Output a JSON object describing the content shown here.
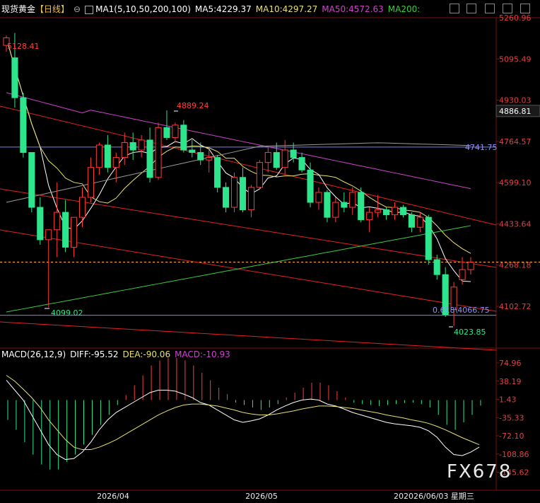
{
  "header": {
    "symbol": "现货黄金",
    "period": "【日线】",
    "ma_label": "MA1(5,10,50,200,100)",
    "ma5": "MA5:4229.37",
    "ma10": "MA10:4297.27",
    "ma50": "MA50:4572.63",
    "ma200": "MA200:"
  },
  "macd_header": {
    "label": "MACD(26,12,9)",
    "diff": "DIFF:-95.52",
    "dea": "DEA:-90.06",
    "macd": "MACD:-10.93"
  },
  "watermark": "FX678",
  "colors": {
    "up": "#ff3b3b",
    "down": "#2ee58e",
    "ma5": "#ffffff",
    "ma10": "#e8e070",
    "ma50": "#d040d0",
    "ma200": "#3ccc3c",
    "ma100": "#9a9a9a",
    "channel": "#e52020",
    "hline": "#8080ff",
    "current": "#ffb040"
  },
  "chart_data": {
    "type": "candlestick",
    "y_ticks": [
      "5260.96",
      "5095.49",
      "4930.03",
      "4764.57",
      "4599.10",
      "4433.64",
      "4268.18",
      "4102.72"
    ],
    "current_price_label": "4886.81",
    "hline_label": "4741.75",
    "x_labels": [
      "2026/04",
      "2026/05",
      "2026/06/03 星期三"
    ],
    "annotations": [
      "5128.41",
      "4889.24",
      "4099.02",
      "4023.85",
      "0.618\\4066.75"
    ],
    "candles": [
      {
        "o": 5150,
        "h": 5190,
        "l": 5125,
        "c": 5180
      },
      {
        "o": 5100,
        "h": 5200,
        "l": 4900,
        "c": 4940
      },
      {
        "o": 4940,
        "h": 4960,
        "l": 4700,
        "c": 4720
      },
      {
        "o": 4720,
        "h": 4720,
        "l": 4480,
        "c": 4500
      },
      {
        "o": 4500,
        "h": 4540,
        "l": 4350,
        "c": 4370
      },
      {
        "o": 4370,
        "h": 4400,
        "l": 4099,
        "c": 4410
      },
      {
        "o": 4410,
        "h": 4600,
        "l": 4300,
        "c": 4480
      },
      {
        "o": 4480,
        "h": 4530,
        "l": 4320,
        "c": 4340
      },
      {
        "o": 4340,
        "h": 4460,
        "l": 4300,
        "c": 4460
      },
      {
        "o": 4460,
        "h": 4580,
        "l": 4420,
        "c": 4540
      },
      {
        "o": 4540,
        "h": 4700,
        "l": 4520,
        "c": 4660
      },
      {
        "o": 4660,
        "h": 4760,
        "l": 4630,
        "c": 4750
      },
      {
        "o": 4750,
        "h": 4790,
        "l": 4640,
        "c": 4660
      },
      {
        "o": 4660,
        "h": 4720,
        "l": 4600,
        "c": 4700
      },
      {
        "o": 4700,
        "h": 4800,
        "l": 4670,
        "c": 4760
      },
      {
        "o": 4760,
        "h": 4800,
        "l": 4690,
        "c": 4730
      },
      {
        "o": 4730,
        "h": 4790,
        "l": 4700,
        "c": 4770
      },
      {
        "o": 4770,
        "h": 4820,
        "l": 4600,
        "c": 4620
      },
      {
        "o": 4620,
        "h": 4840,
        "l": 4610,
        "c": 4820
      },
      {
        "o": 4820,
        "h": 4889,
        "l": 4770,
        "c": 4780
      },
      {
        "o": 4780,
        "h": 4840,
        "l": 4760,
        "c": 4830
      },
      {
        "o": 4830,
        "h": 4850,
        "l": 4720,
        "c": 4730
      },
      {
        "o": 4730,
        "h": 4770,
        "l": 4700,
        "c": 4720
      },
      {
        "o": 4720,
        "h": 4760,
        "l": 4670,
        "c": 4690
      },
      {
        "o": 4690,
        "h": 4730,
        "l": 4640,
        "c": 4700
      },
      {
        "o": 4700,
        "h": 4710,
        "l": 4560,
        "c": 4580
      },
      {
        "o": 4580,
        "h": 4600,
        "l": 4480,
        "c": 4500
      },
      {
        "o": 4500,
        "h": 4640,
        "l": 4480,
        "c": 4620
      },
      {
        "o": 4620,
        "h": 4660,
        "l": 4480,
        "c": 4490
      },
      {
        "o": 4490,
        "h": 4590,
        "l": 4460,
        "c": 4580
      },
      {
        "o": 4580,
        "h": 4690,
        "l": 4570,
        "c": 4680
      },
      {
        "o": 4680,
        "h": 4740,
        "l": 4640,
        "c": 4720
      },
      {
        "o": 4720,
        "h": 4760,
        "l": 4650,
        "c": 4660
      },
      {
        "o": 4660,
        "h": 4770,
        "l": 4630,
        "c": 4730
      },
      {
        "o": 4730,
        "h": 4760,
        "l": 4680,
        "c": 4700
      },
      {
        "o": 4700,
        "h": 4720,
        "l": 4640,
        "c": 4650
      },
      {
        "o": 4650,
        "h": 4680,
        "l": 4500,
        "c": 4520
      },
      {
        "o": 4520,
        "h": 4580,
        "l": 4490,
        "c": 4560
      },
      {
        "o": 4560,
        "h": 4570,
        "l": 4440,
        "c": 4460
      },
      {
        "o": 4460,
        "h": 4540,
        "l": 4440,
        "c": 4520
      },
      {
        "o": 4520,
        "h": 4560,
        "l": 4480,
        "c": 4500
      },
      {
        "o": 4500,
        "h": 4580,
        "l": 4470,
        "c": 4560
      },
      {
        "o": 4560,
        "h": 4580,
        "l": 4440,
        "c": 4450
      },
      {
        "o": 4450,
        "h": 4500,
        "l": 4400,
        "c": 4480
      },
      {
        "o": 4480,
        "h": 4550,
        "l": 4460,
        "c": 4490
      },
      {
        "o": 4490,
        "h": 4500,
        "l": 4450,
        "c": 4470
      },
      {
        "o": 4470,
        "h": 4520,
        "l": 4450,
        "c": 4500
      },
      {
        "o": 4500,
        "h": 4510,
        "l": 4460,
        "c": 4470
      },
      {
        "o": 4470,
        "h": 4480,
        "l": 4400,
        "c": 4420
      },
      {
        "o": 4420,
        "h": 4480,
        "l": 4400,
        "c": 4460
      },
      {
        "o": 4460,
        "h": 4470,
        "l": 4270,
        "c": 4290
      },
      {
        "o": 4290,
        "h": 4310,
        "l": 4210,
        "c": 4230
      },
      {
        "o": 4230,
        "h": 4260,
        "l": 4060,
        "c": 4070
      },
      {
        "o": 4090,
        "h": 4200,
        "l": 4024,
        "c": 4180
      },
      {
        "o": 4210,
        "h": 4300,
        "l": 4190,
        "c": 4250
      },
      {
        "o": 4250,
        "h": 4300,
        "l": 4230,
        "c": 4280
      }
    ],
    "macd_ticks": [
      "74.96",
      "38.19",
      "1.43",
      "-35.33",
      "-72.10",
      "-108.86",
      "-145.62"
    ],
    "macd_hist": [
      -40,
      -60,
      -85,
      -110,
      -130,
      -140,
      -140,
      -125,
      -110,
      -90,
      -70,
      -50,
      -30,
      -10,
      10,
      30,
      50,
      70,
      80,
      85,
      85,
      80,
      70,
      55,
      40,
      25,
      12,
      -5,
      -10,
      -15,
      -20,
      -15,
      -8,
      5,
      15,
      25,
      35,
      35,
      30,
      18,
      5,
      -5,
      -8,
      -10,
      -12,
      -10,
      -8,
      -6,
      -5,
      -8,
      -15,
      -30,
      -50,
      -60,
      -45,
      -30,
      -11
    ],
    "macd_diff": [
      40,
      20,
      0,
      -30,
      -60,
      -90,
      -110,
      -120,
      -118,
      -105,
      -85,
      -60,
      -40,
      -25,
      -15,
      -5,
      5,
      15,
      20,
      20,
      18,
      12,
      5,
      -5,
      -10,
      -20,
      -30,
      -40,
      -45,
      -42,
      -38,
      -30,
      -20,
      -12,
      -5,
      0,
      2,
      0,
      -8,
      -12,
      -18,
      -25,
      -30,
      -35,
      -40,
      -45,
      -48,
      -50,
      -52,
      -55,
      -62,
      -75,
      -95,
      -110,
      -112,
      -105,
      -95
    ],
    "macd_dea": [
      50,
      38,
      22,
      5,
      -15,
      -40,
      -60,
      -80,
      -95,
      -100,
      -100,
      -95,
      -88,
      -80,
      -70,
      -60,
      -50,
      -40,
      -30,
      -22,
      -15,
      -10,
      -8,
      -8,
      -10,
      -12,
      -16,
      -20,
      -25,
      -28,
      -30,
      -30,
      -28,
      -25,
      -22,
      -18,
      -15,
      -12,
      -12,
      -13,
      -15,
      -17,
      -20,
      -23,
      -26,
      -30,
      -33,
      -36,
      -40,
      -43,
      -47,
      -53,
      -60,
      -68,
      -76,
      -83,
      -90
    ]
  }
}
